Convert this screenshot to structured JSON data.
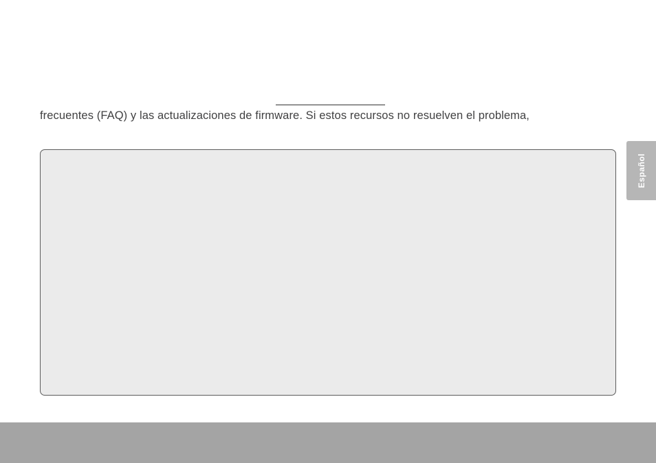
{
  "document": {
    "visible_text": "frecuentes (FAQ) y las actualizaciones de firmware. Si estos recursos no resuelven el problema,",
    "language_tab": "Español"
  }
}
